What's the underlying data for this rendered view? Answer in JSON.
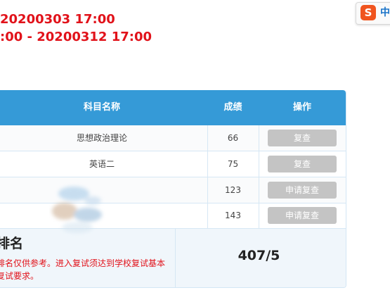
{
  "header": {
    "line1": "20200303 17:00",
    "line2": ":00 - 20200312 17:00"
  },
  "ime": {
    "logo": "S",
    "mode": "中"
  },
  "table": {
    "columns": {
      "subject": "科目名称",
      "score": "成绩",
      "action": "操作"
    },
    "rows": [
      {
        "subject": "思想政治理论",
        "score": "66",
        "action": "复查"
      },
      {
        "subject": "英语二",
        "score": "75",
        "action": "复查"
      },
      {
        "subject": "",
        "score": "123",
        "action": "申请复查"
      },
      {
        "subject": "",
        "score": "143",
        "action": "申请复查"
      }
    ],
    "rank": {
      "title": "排名",
      "note": "排名仅供参考。进入复试须达到学校复试基本复试要求。",
      "value": "407/5"
    }
  },
  "colors": {
    "accent": "#359ad7",
    "alert": "#e1121a",
    "button_disabled": "#c4c4c4"
  }
}
